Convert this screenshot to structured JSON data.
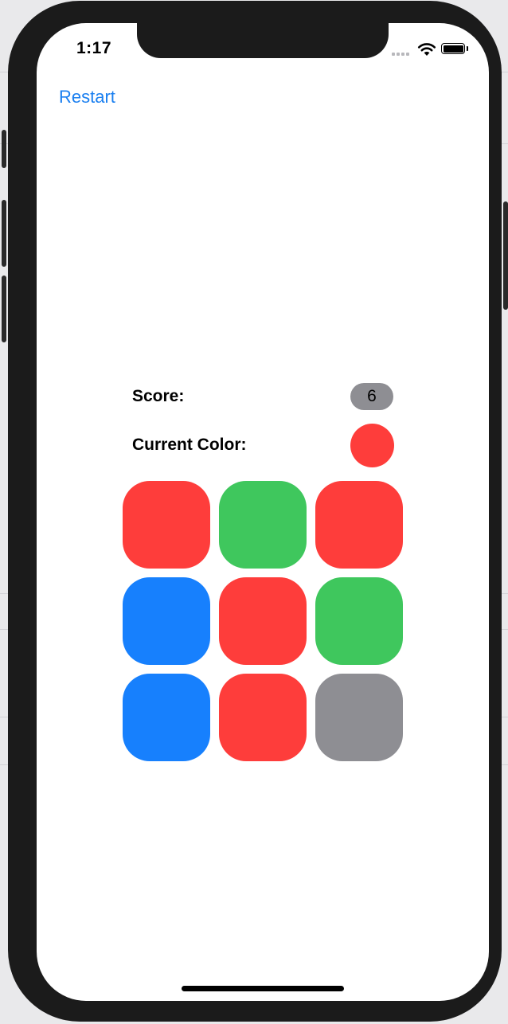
{
  "status_bar": {
    "time": "1:17",
    "icons": [
      "cellular-signal-icon",
      "wifi-icon",
      "battery-icon"
    ]
  },
  "nav": {
    "restart_label": "Restart"
  },
  "game": {
    "score_label": "Score:",
    "score_value": "6",
    "current_color_label": "Current Color:",
    "current_color": "#fe3d3b",
    "tiles": [
      {
        "color_name": "red",
        "color": "#fe3d3b"
      },
      {
        "color_name": "green",
        "color": "#3fc75d"
      },
      {
        "color_name": "red",
        "color": "#fe3d3b"
      },
      {
        "color_name": "blue",
        "color": "#1780fd"
      },
      {
        "color_name": "red",
        "color": "#fe3d3b"
      },
      {
        "color_name": "green",
        "color": "#3fc75d"
      },
      {
        "color_name": "blue",
        "color": "#1780fd"
      },
      {
        "color_name": "red",
        "color": "#fe3d3b"
      },
      {
        "color_name": "gray",
        "color": "#8e8e93"
      }
    ]
  },
  "colors": {
    "accent": "#1a7ff0",
    "badge_gray": "#8e8e93",
    "device_frame": "#1b1b1b"
  }
}
